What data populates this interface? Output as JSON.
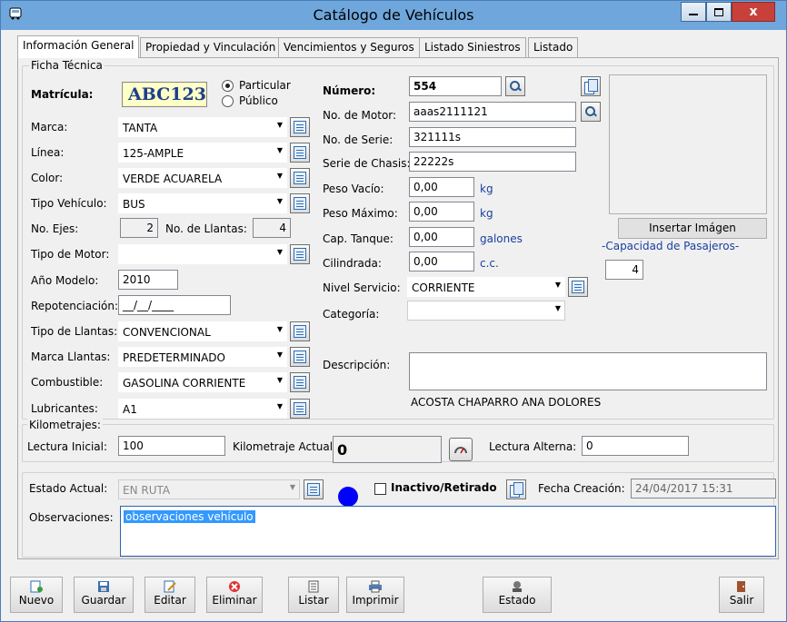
{
  "window": {
    "title": "Catálogo de Vehículos"
  },
  "tabs": [
    "Información General",
    "Propiedad y Vinculación",
    "Vencimientos y Seguros",
    "Listado Siniestros",
    "Listado"
  ],
  "ficha": {
    "group_label": "Ficha Técnica",
    "matricula_label": "Matrícula:",
    "matricula_value": "ABC123",
    "radio_particular": "Particular",
    "radio_publico": "Público",
    "marca_label": "Marca:",
    "marca_value": "TANTA",
    "linea_label": "Línea:",
    "linea_value": "125-AMPLE",
    "color_label": "Color:",
    "color_value": "VERDE ACUARELA",
    "tipo_vehiculo_label": "Tipo Vehículo:",
    "tipo_vehiculo_value": "BUS",
    "ejes_label": "No. Ejes:",
    "ejes_value": "2",
    "llantas_label": "No. de Llantas:",
    "llantas_value": "4",
    "tipo_motor_label": "Tipo de Motor:",
    "tipo_motor_value": "",
    "anio_label": "Año Modelo:",
    "anio_value": "2010",
    "repot_label": "Repotenciación:",
    "repot_value": "__/__/____",
    "tipo_llantas_label": "Tipo de Llantas:",
    "tipo_llantas_value": "CONVENCIONAL",
    "marca_llantas_label": "Marca Llantas:",
    "marca_llantas_value": "PREDETERMINADO",
    "combustible_label": "Combustible:",
    "combustible_value": "GASOLINA CORRIENTE",
    "lubricantes_label": "Lubricantes:",
    "lubricantes_value": "A1",
    "numero_label": "Número:",
    "numero_value": "554",
    "motor_label": "No. de Motor:",
    "motor_value": "aaas2111121",
    "serie_label": "No. de Serie:",
    "serie_value": "321111s",
    "chasis_label": "Serie de Chasis:",
    "chasis_value": "22222s",
    "peso_vacio_label": "Peso Vacío:",
    "peso_vacio_value": "0,00",
    "peso_vacio_unit": "kg",
    "peso_max_label": "Peso Máximo:",
    "peso_max_value": "0,00",
    "peso_max_unit": "kg",
    "tanque_label": "Cap. Tanque:",
    "tanque_value": "0,00",
    "tanque_unit": "galones",
    "cilindrada_label": "Cilindrada:",
    "cilindrada_value": "0,00",
    "cilindrada_unit": "c.c.",
    "nivel_label": "Nivel Servicio:",
    "nivel_value": "CORRIENTE",
    "categoria_label": "Categoría:",
    "categoria_value": "",
    "descripcion_label": "Descripción:",
    "owner_name": "ACOSTA CHAPARRO ANA DOLORES",
    "insertar_imagen": "Insertar Imágen",
    "capacidad_label": "-Capacidad de Pasajeros-",
    "capacidad_value": "4"
  },
  "km": {
    "group_label": "Kilometrajes:",
    "inicial_label": "Lectura Inicial:",
    "inicial_value": "100",
    "actual_label": "Kilometraje Actual:",
    "actual_value": "0",
    "alterna_label": "Lectura Alterna:",
    "alterna_value": "0"
  },
  "estado": {
    "label": "Estado Actual:",
    "value": "EN RUTA",
    "status_color": "#0000ff",
    "inactivo_label": "Inactivo/Retirado",
    "fecha_label": "Fecha Creación:",
    "fecha_value": "24/04/2017 15:31",
    "obs_label": "Observaciones:",
    "obs_value": "observaciones vehículo"
  },
  "toolbar": {
    "nuevo": "Nuevo",
    "guardar": "Guardar",
    "editar": "Editar",
    "eliminar": "Eliminar",
    "listar": "Listar",
    "imprimir": "Imprimir",
    "estado": "Estado",
    "salir": "Salir"
  },
  "icons": [
    "bus-icon",
    "list-icon",
    "search-icon",
    "copy-icon",
    "gauge-icon"
  ]
}
